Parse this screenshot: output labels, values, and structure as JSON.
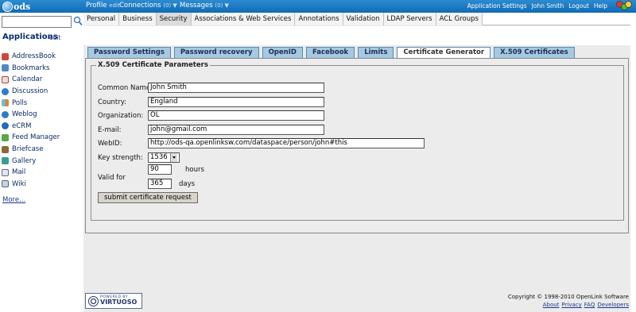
{
  "topbar": {
    "logo_text": "ods",
    "profile": "Profile",
    "profile_edit": "edit",
    "connections": "Connections",
    "connections_count": "(0) ▼",
    "messages": "Messages",
    "messages_count": "(0) ▼",
    "links": [
      "Application Settings",
      "John Smith",
      "Logout",
      "Help"
    ],
    "accent_color": "#1a77c0"
  },
  "sidebar": {
    "search_placeholder": "",
    "title": "Applications",
    "edit": "edit",
    "items": [
      {
        "label": "AddressBook",
        "icon": "addressbook-icon"
      },
      {
        "label": "Bookmarks",
        "icon": "bookmarks-icon"
      },
      {
        "label": "Calendar",
        "icon": "calendar-icon"
      },
      {
        "label": "Discussion",
        "icon": "discussion-icon"
      },
      {
        "label": "Polls",
        "icon": "polls-icon"
      },
      {
        "label": "Weblog",
        "icon": "weblog-icon"
      },
      {
        "label": "eCRM",
        "icon": "ecrm-icon"
      },
      {
        "label": "Feed Manager",
        "icon": "feed-icon"
      },
      {
        "label": "Briefcase",
        "icon": "briefcase-icon"
      },
      {
        "label": "Gallery",
        "icon": "gallery-icon"
      },
      {
        "label": "Mail",
        "icon": "mail-icon"
      },
      {
        "label": "Wiki",
        "icon": "wiki-icon"
      }
    ],
    "more": "More..."
  },
  "settings_tabs": [
    "Personal",
    "Business",
    "Security",
    "Associations & Web Services",
    "Annotations",
    "Validation",
    "LDAP Servers",
    "ACL Groups"
  ],
  "security_tabs": [
    "Password Settings",
    "Password recovery",
    "OpenID",
    "Facebook",
    "Limits",
    "Certificate Generator",
    "X.509 Certificates"
  ],
  "form": {
    "legend": "X.509 Certificate Parameters",
    "common_name_label": "Common Name:",
    "common_name_value": "John Smith",
    "country_label": "Country:",
    "country_value": "England",
    "organization_label": "Organization:",
    "organization_value": "OL",
    "email_label": "E-mail:",
    "email_value": "john@gmail.com",
    "webid_label": "WebID:",
    "webid_value": "http://ods-qa.openlinksw.com/dataspace/person/john#this",
    "key_strength_label": "Key strength:",
    "key_strength_value": "1536",
    "valid_for_label": "Valid for",
    "hours_value": "90",
    "hours_unit": "hours",
    "days_value": "365",
    "days_unit": "days",
    "submit_label": "submit certificate request"
  },
  "footer": {
    "powered_small": "POWERED BY",
    "powered_big": "VIRTUOSO",
    "copyright": "Copyright © 1998-2010 OpenLink Software",
    "links": [
      "About",
      "Privacy",
      "FAQ",
      "Developers"
    ]
  }
}
